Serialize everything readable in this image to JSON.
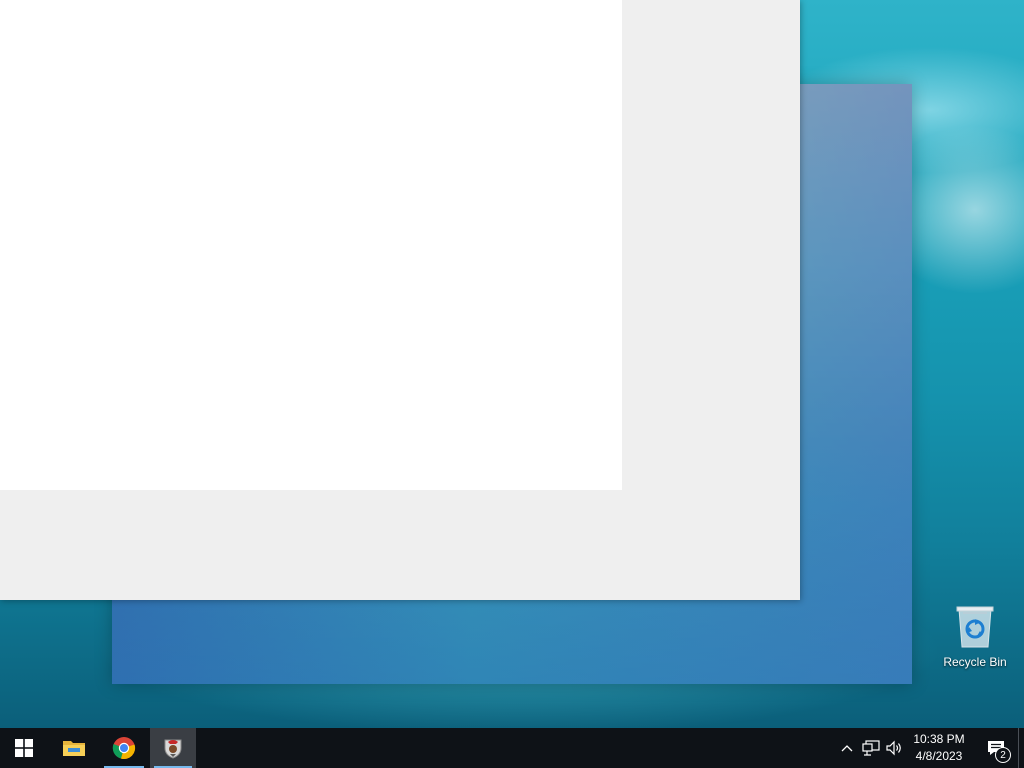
{
  "desktop": {
    "icons": [
      {
        "label": "Recycle Bin",
        "icon": "recycle-bin-icon"
      }
    ]
  },
  "taskbar": {
    "start_icon": "windows-logo-icon",
    "pinned": [
      {
        "name": "File Explorer",
        "icon": "folder-icon"
      },
      {
        "name": "Google Chrome",
        "icon": "chrome-icon",
        "running": true
      },
      {
        "name": "Game app",
        "icon": "game-app-icon",
        "running": true,
        "active": true
      }
    ],
    "tray": {
      "icons": [
        "chevron-up-icon",
        "network-icon",
        "volume-icon"
      ],
      "time": "10:38 PM",
      "date": "4/8/2023",
      "notification_count": "2"
    }
  },
  "colors": {
    "taskbar": "#0e1217",
    "window_bg": "#efefef",
    "panel_bg": "#ffffff",
    "accent": "#76b9ed"
  }
}
